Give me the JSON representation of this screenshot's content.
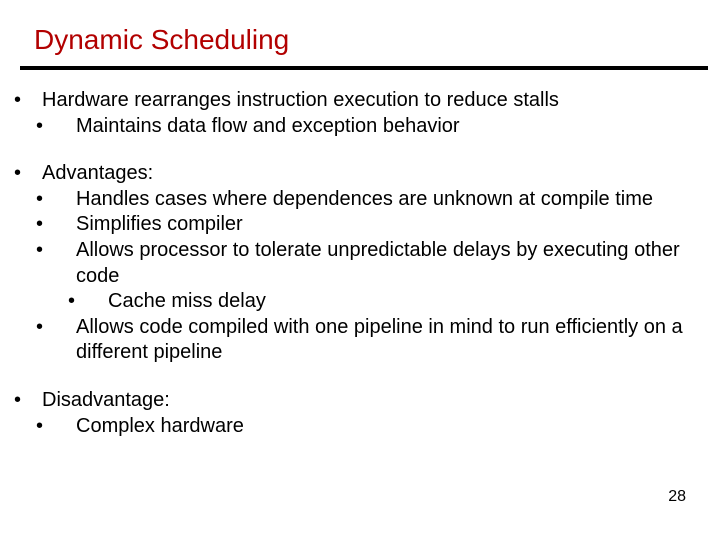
{
  "title": "Dynamic Scheduling",
  "sections": [
    {
      "heading": "Hardware rearranges instruction execution to reduce stalls",
      "items": [
        {
          "text": "Maintains data flow and exception behavior"
        }
      ]
    },
    {
      "heading": "Advantages:",
      "items": [
        {
          "text": "Handles cases where dependences are unknown at compile time"
        },
        {
          "text": "Simplifies compiler"
        },
        {
          "text": "Allows processor to tolerate unpredictable delays by executing other code",
          "subitems": [
            "Cache miss delay"
          ]
        },
        {
          "text": "Allows code compiled with one pipeline in mind to run efficiently on a different pipeline"
        }
      ]
    },
    {
      "heading": "Disadvantage:",
      "items": [
        {
          "text": "Complex hardware"
        }
      ]
    }
  ],
  "page_number": "28",
  "bullets": {
    "l1": "•",
    "l2": "•",
    "l3": "•"
  }
}
